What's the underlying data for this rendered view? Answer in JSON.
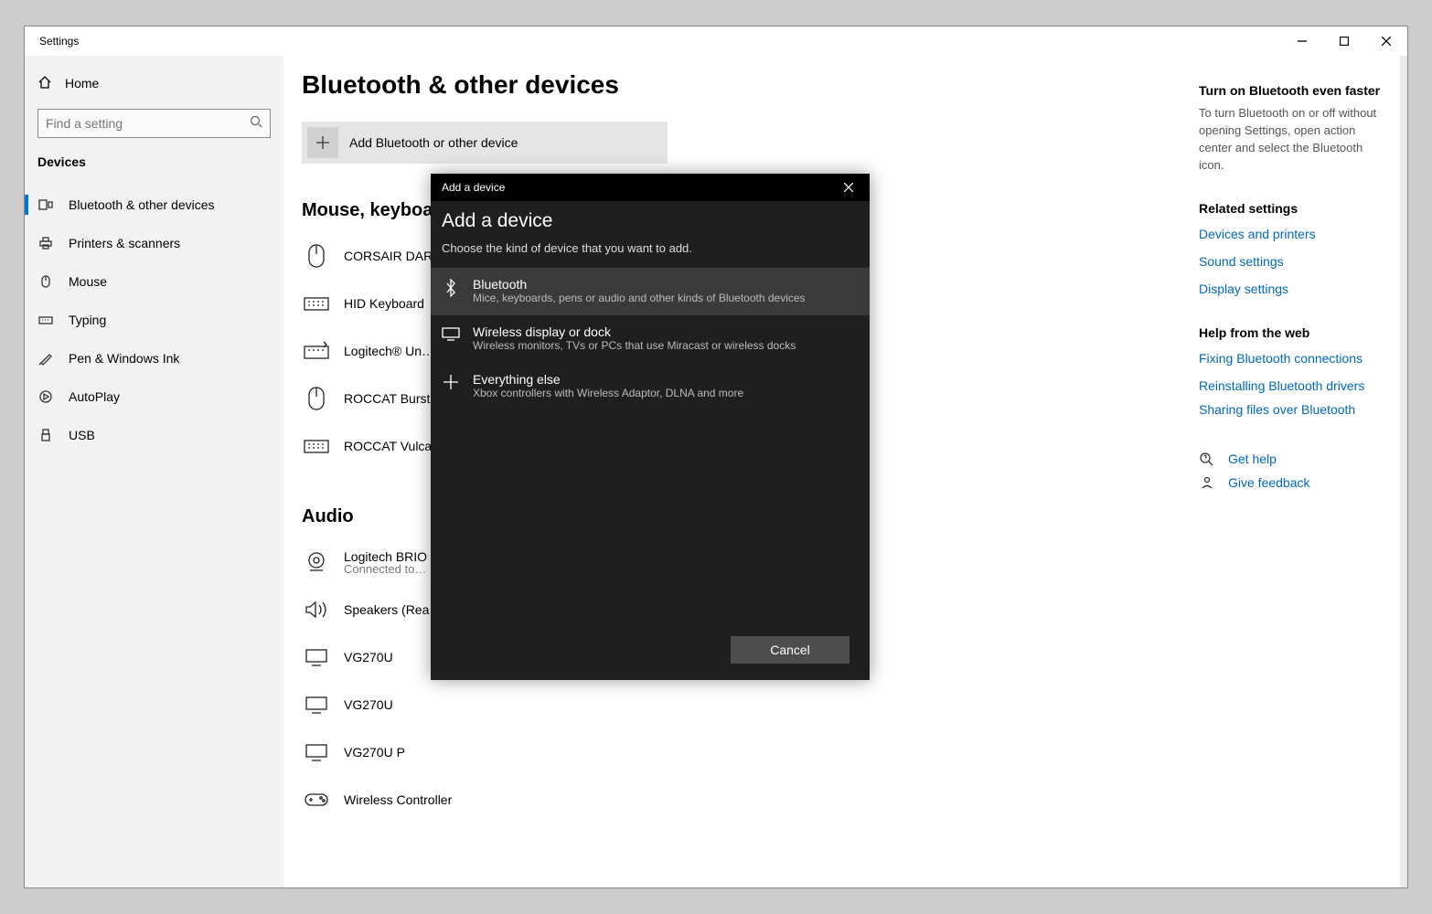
{
  "window": {
    "title": "Settings"
  },
  "sidebar": {
    "home": "Home",
    "search_placeholder": "Find a setting",
    "category": "Devices",
    "items": [
      {
        "label": "Bluetooth & other devices",
        "active": true
      },
      {
        "label": "Printers & scanners"
      },
      {
        "label": "Mouse"
      },
      {
        "label": "Typing"
      },
      {
        "label": "Pen & Windows Ink"
      },
      {
        "label": "AutoPlay"
      },
      {
        "label": "USB"
      }
    ]
  },
  "page": {
    "title": "Bluetooth & other devices",
    "add_label": "Add Bluetooth or other device",
    "section_input": "Mouse, keyboard, & pen",
    "devices_input": [
      {
        "name": "CORSAIR DAR…"
      },
      {
        "name": "HID Keyboard"
      },
      {
        "name": "Logitech® Un…"
      },
      {
        "name": "ROCCAT Burst…"
      },
      {
        "name": "ROCCAT Vulca…"
      }
    ],
    "section_audio": "Audio",
    "devices_audio": [
      {
        "name": "Logitech BRIO",
        "sub": "Connected to…"
      },
      {
        "name": "Speakers (Rea…"
      },
      {
        "name": "VG270U"
      },
      {
        "name": "VG270U"
      },
      {
        "name": "VG270U P"
      },
      {
        "name": "Wireless Controller"
      }
    ]
  },
  "right": {
    "tip_title": "Turn on Bluetooth even faster",
    "tip_body": "To turn Bluetooth on or off without opening Settings, open action center and select the Bluetooth icon.",
    "related_head": "Related settings",
    "related": [
      "Devices and printers",
      "Sound settings",
      "Display settings"
    ],
    "help_head": "Help from the web",
    "help": [
      "Fixing Bluetooth connections",
      "Reinstalling Bluetooth drivers",
      "Sharing files over Bluetooth"
    ],
    "get_help": "Get help",
    "give_feedback": "Give feedback"
  },
  "modal": {
    "bar": "Add a device",
    "title": "Add a device",
    "subtitle": "Choose the kind of device that you want to add.",
    "options": [
      {
        "title": "Bluetooth",
        "desc": "Mice, keyboards, pens or audio and other kinds of Bluetooth devices"
      },
      {
        "title": "Wireless display or dock",
        "desc": "Wireless monitors, TVs or PCs that use Miracast or wireless docks"
      },
      {
        "title": "Everything else",
        "desc": "Xbox controllers with Wireless Adaptor, DLNA and more"
      }
    ],
    "cancel": "Cancel"
  }
}
